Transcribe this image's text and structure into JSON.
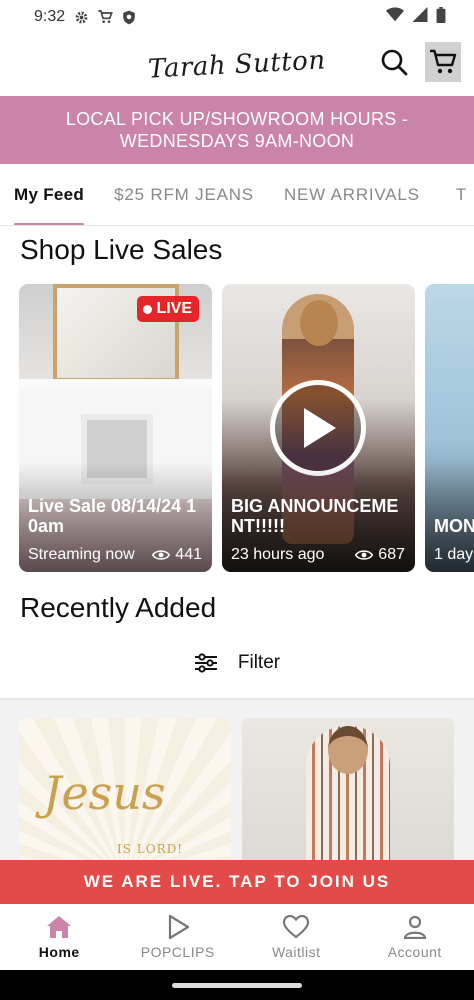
{
  "status_bar": {
    "time": "9:32"
  },
  "header": {
    "logo_text": "Tarah Sutton"
  },
  "banner": {
    "text": "LOCAL PICK UP/SHOWROOM HOURS - WEDNESDAYS 9AM-NOON"
  },
  "tabs": [
    {
      "label": "My Feed",
      "active": true
    },
    {
      "label": "$25 RFM JEANS",
      "active": false
    },
    {
      "label": "NEW ARRIVALS",
      "active": false
    },
    {
      "label": "T",
      "active": false
    }
  ],
  "live_sales": {
    "title": "Shop Live Sales",
    "cards": [
      {
        "badge": "LIVE",
        "title": "Live Sale 08/14/24 10am",
        "status": "Streaming now",
        "views": "441"
      },
      {
        "title": "BIG ANNOUNCEMENT!!!!!",
        "status": "23 hours ago",
        "views": "687"
      },
      {
        "title": "MON FUN",
        "status": "1 day"
      }
    ]
  },
  "recently_added": {
    "title": "Recently Added",
    "filter_label": "Filter",
    "tiles": [
      {
        "text_main": "Jesus",
        "text_sub": "IS LORD!"
      },
      {
        "text_main": ""
      }
    ]
  },
  "live_bar": {
    "text": "WE ARE LIVE. TAP TO JOIN US"
  },
  "bottom_nav": [
    {
      "label": "Home",
      "icon": "home-icon",
      "active": true
    },
    {
      "label": "POPCLIPS",
      "icon": "play-icon",
      "active": false
    },
    {
      "label": "Waitlist",
      "icon": "heart-icon",
      "active": false
    },
    {
      "label": "Account",
      "icon": "person-icon",
      "active": false
    }
  ],
  "colors": {
    "brand_pink": "#c984a8",
    "live_red": "#e34b4b",
    "badge_red": "#e4262a"
  }
}
